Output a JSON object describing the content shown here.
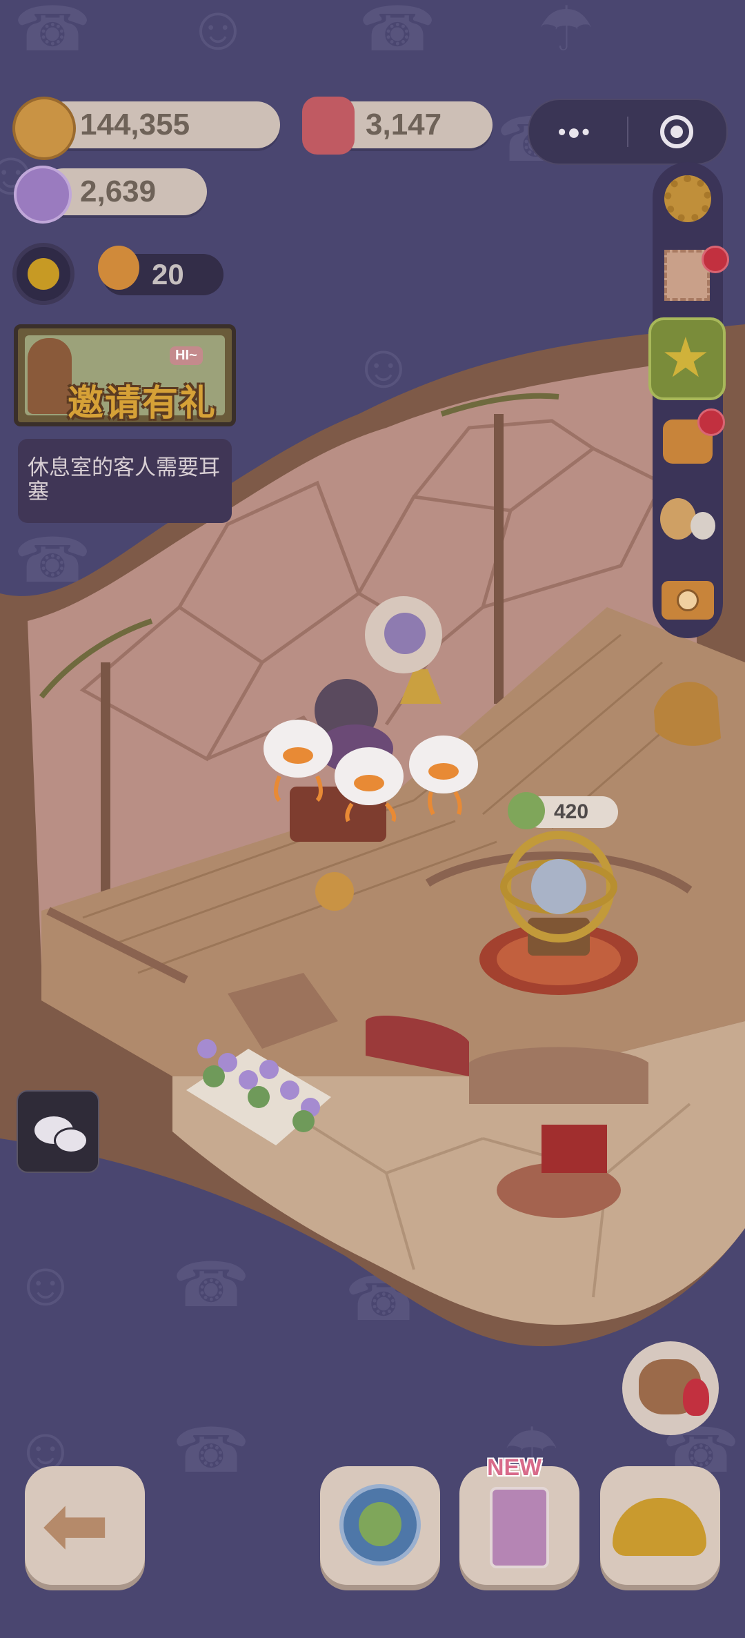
{
  "currency": {
    "cookies": "144,355",
    "gems": "3,147",
    "candy": "2,639",
    "tickets": "20"
  },
  "invite_banner": {
    "text": "邀请有礼",
    "badge": "HI~"
  },
  "tip": {
    "text": "休息室的客人需要耳塞"
  },
  "scene": {
    "astrolabe_price": "420"
  },
  "bottom_bar": {
    "new_badge": "NEW"
  },
  "colors": {
    "background": "#4a4670",
    "pill": "#cdbfb6",
    "accent_red": "#c2303f"
  }
}
